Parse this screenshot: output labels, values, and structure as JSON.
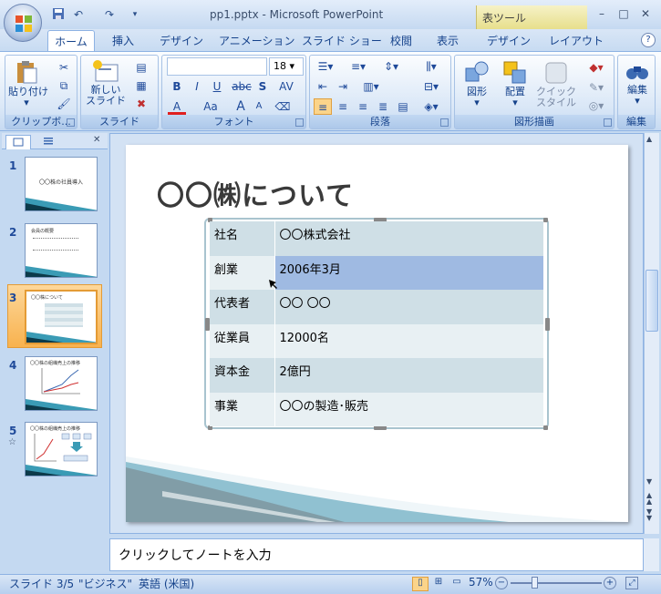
{
  "window": {
    "title": "pp1.pptx - Microsoft PowerPoint",
    "contextual_tab_group": "表ツール",
    "min": "–",
    "max": "□",
    "close": "✕"
  },
  "qat": {
    "undo": "↶",
    "redo": "↷",
    "more": "▾"
  },
  "tabs": [
    "ホーム",
    "挿入",
    "デザイン",
    "アニメーション",
    "スライド ショー",
    "校閲",
    "表示",
    "デザイン",
    "レイアウト"
  ],
  "ribbon": {
    "clipboard": {
      "label": "クリップボ...",
      "paste": "貼り付け",
      "paste_arrow": "▾"
    },
    "slides": {
      "label": "スライド",
      "new_slide_1": "新しい",
      "new_slide_2": "スライド"
    },
    "font": {
      "label": "フォント",
      "font_name": "",
      "font_size": "18",
      "bold": "B",
      "italic": "I",
      "underline": "U",
      "strike": "abc",
      "shadow": "S",
      "spacing": "AV",
      "font_color": "A",
      "case": "Aa",
      "grow": "A",
      "shrink": "A"
    },
    "paragraph": {
      "label": "段落"
    },
    "drawing": {
      "label": "図形描画",
      "shapes": "図形",
      "arrange": "配置",
      "quick_1": "クイック",
      "quick_2": "スタイル"
    },
    "editing": {
      "label": "編集",
      "edit": "編集"
    }
  },
  "thumbnails": [
    {
      "num": "1",
      "title": "〇〇株の社員導入"
    },
    {
      "num": "2",
      "title": "会員の概要"
    },
    {
      "num": "3",
      "title": "〇〇株について"
    },
    {
      "num": "4",
      "title": "〇〇株の組織売上の推移"
    },
    {
      "num": "5",
      "title": "〇〇株の組織売上の推移",
      "star": "☆"
    }
  ],
  "slide": {
    "title": "〇〇㈱について",
    "rows": [
      {
        "k": "社名",
        "v": "〇〇株式会社"
      },
      {
        "k": "創業",
        "v": "2006年3月"
      },
      {
        "k": "代表者",
        "v": "〇〇 〇〇"
      },
      {
        "k": "従業員",
        "v": "12000名"
      },
      {
        "k": "資本金",
        "v": "2億円"
      },
      {
        "k": "事業",
        "v": "〇〇の製造･販売"
      }
    ]
  },
  "notes_placeholder": "クリックしてノートを入力",
  "status": {
    "slide": "スライド 3/5",
    "theme": "\"ビジネス\"",
    "lang": "英語 (米国)",
    "zoom": "57%"
  },
  "colors": {
    "accent": "#15428b",
    "ribbon": "#dbe8f7",
    "selected_thumb": "#f8b24e",
    "table_row": "#cfdfe6"
  }
}
